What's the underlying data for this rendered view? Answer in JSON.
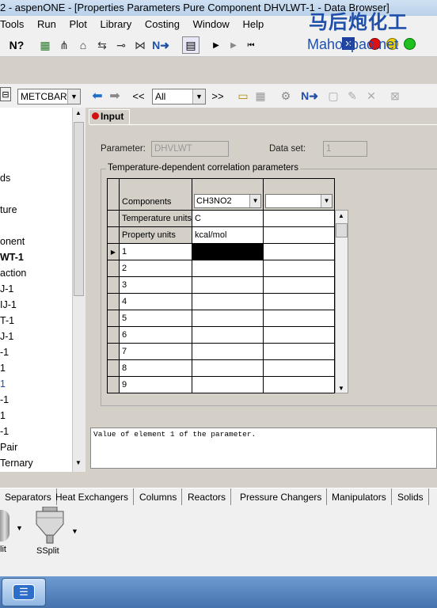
{
  "window": {
    "title": "2 - aspenONE - [Properties Parameters Pure Component DHVLWT-1 - Data Browser]"
  },
  "watermark": {
    "cn": "马后炮化工",
    "site": "Mahoupao.net"
  },
  "menu": [
    "Tools",
    "Run",
    "Plot",
    "Library",
    "Costing",
    "Window",
    "Help"
  ],
  "toolbar2": {
    "units_combo": "METCBAR",
    "filter_combo": "All",
    "prev_label": "<<",
    "next_label": ">>"
  },
  "tree": {
    "items": [
      {
        "label": "ds",
        "bold": false,
        "color": "#000000"
      },
      {
        "label": "ture",
        "bold": false,
        "color": "#000000"
      },
      {
        "label": "onent",
        "bold": false,
        "color": "#000000"
      },
      {
        "label": "WT-1",
        "bold": true,
        "color": "#000000"
      },
      {
        "label": "action",
        "bold": false,
        "color": "#000000"
      },
      {
        "label": "J-1",
        "bold": false,
        "color": "#000000"
      },
      {
        "label": "IJ-1",
        "bold": false,
        "color": "#000000"
      },
      {
        "label": "T-1",
        "bold": false,
        "color": "#000000"
      },
      {
        "label": "J-1",
        "bold": false,
        "color": "#000000"
      },
      {
        "label": "-1",
        "bold": false,
        "color": "#000000"
      },
      {
        "label": "1",
        "bold": false,
        "color": "#000000"
      },
      {
        "label": "1",
        "bold": false,
        "color": "#1f4fa8"
      },
      {
        "label": "-1",
        "bold": false,
        "color": "#000000"
      },
      {
        "label": "1",
        "bold": false,
        "color": "#000000"
      },
      {
        "label": "-1",
        "bold": false,
        "color": "#000000"
      },
      {
        "label": "Pair",
        "bold": false,
        "color": "#000000"
      },
      {
        "label": "Ternary",
        "bold": false,
        "color": "#000000"
      }
    ]
  },
  "tab": {
    "label": "Input"
  },
  "form": {
    "parameter_label": "Parameter:",
    "parameter_value": "DHVLWT",
    "dataset_label": "Data set:",
    "dataset_value": "1",
    "group_title": "Temperature-dependent correlation parameters"
  },
  "grid": {
    "components_label": "Components",
    "component1": "CH3NO2",
    "component2": "",
    "temp_units_label": "Temperature units",
    "temp_units_value": "C",
    "prop_units_label": "Property units",
    "prop_units_value": "kcal/mol",
    "rows": [
      "1",
      "2",
      "3",
      "4",
      "5",
      "6",
      "7",
      "8",
      "9"
    ]
  },
  "description": "Value of element 1 of the parameter.",
  "palette": {
    "tabs": [
      "Separators",
      "Heat Exchangers",
      "Columns",
      "Reactors",
      "Pressure Changers",
      "Manipulators",
      "Solids"
    ],
    "models": [
      "lit",
      "SSplit"
    ]
  },
  "colors": {
    "accent": "#1f4fa8",
    "selected_cell": "#000000"
  }
}
